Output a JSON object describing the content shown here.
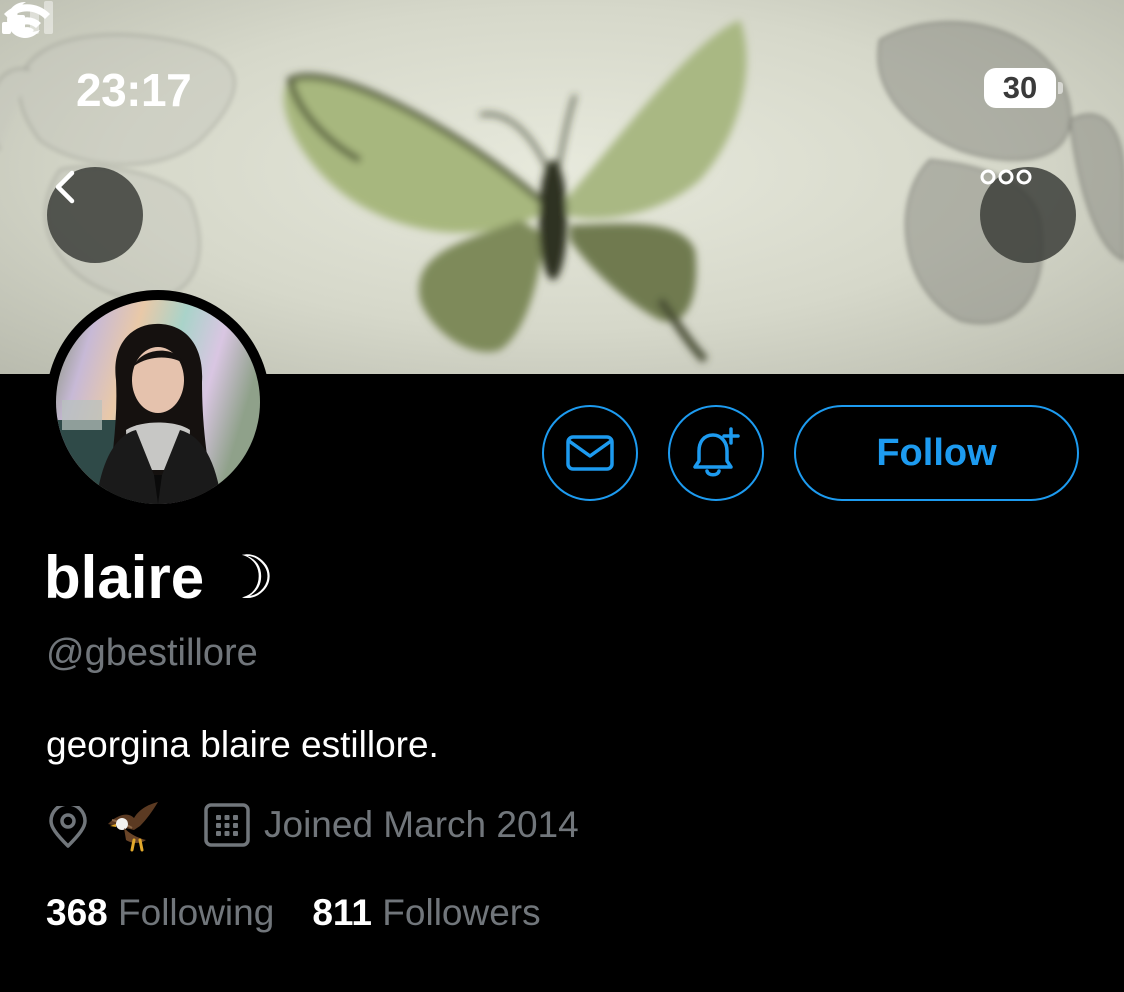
{
  "status_bar": {
    "time": "23:17",
    "focus_mode_icon": "moon-icon",
    "signal_icon": "cellular-signal-icon",
    "wifi_icon": "wifi-icon",
    "battery_level": "30"
  },
  "header": {
    "back_icon": "chevron-left-icon",
    "more_icon": "more-horizontal-icon",
    "banner": "butterfly-banner-image"
  },
  "profile": {
    "display_name": "blaire ☽",
    "handle": "@gbestillore",
    "bio": "georgina blaire estillore.",
    "location_icon": "location-pin-icon",
    "location": "🦅",
    "joined_icon": "calendar-icon",
    "joined": "Joined March 2014",
    "following_count": "368",
    "following_label": "Following",
    "followers_count": "811",
    "followers_label": "Followers"
  },
  "actions": {
    "message_icon": "envelope-icon",
    "notify_icon": "bell-plus-icon",
    "follow_label": "Follow"
  },
  "colors": {
    "background": "#000000",
    "accent": "#1d9bf0",
    "secondary_text": "#71767b",
    "primary_text": "#ffffff"
  }
}
